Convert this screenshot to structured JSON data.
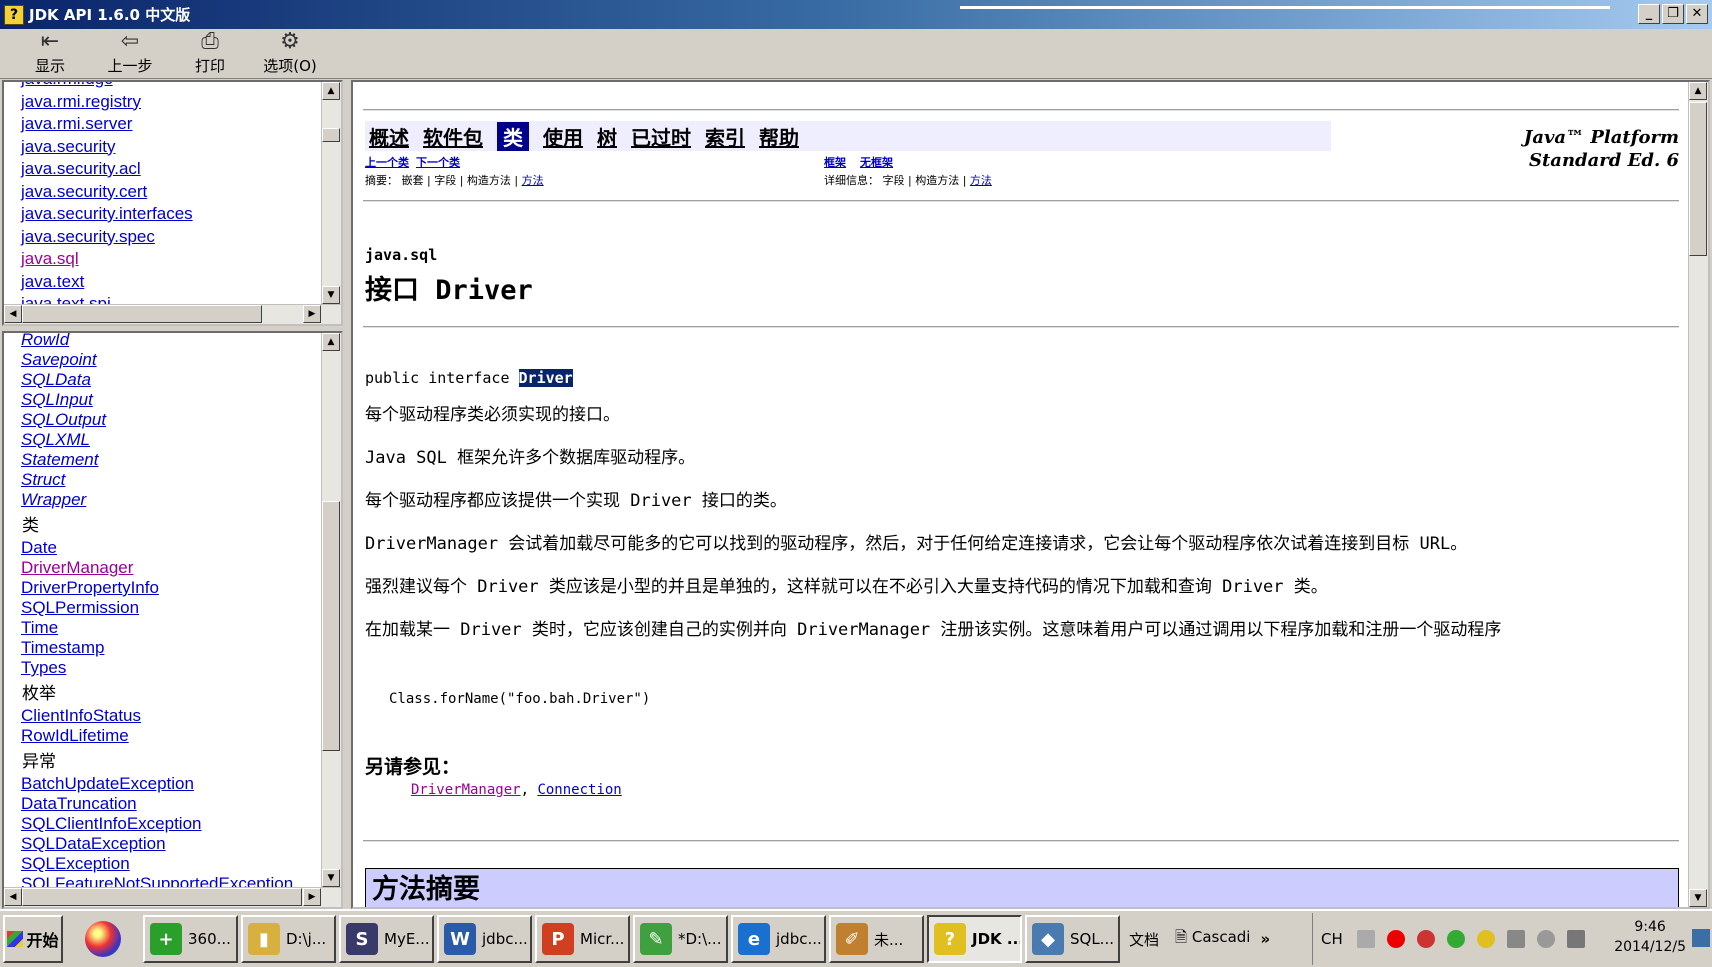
{
  "window": {
    "title": "JDK API 1.6.0 中文版"
  },
  "toolbar": [
    {
      "label": "显示",
      "icon": "show-icon",
      "glyph": "⇤"
    },
    {
      "label": "上一步",
      "icon": "back-icon",
      "glyph": "⇦"
    },
    {
      "label": "打印",
      "icon": "print-icon",
      "glyph": "⎙"
    },
    {
      "label": "选项(O)",
      "icon": "options-icon",
      "glyph": "⚙"
    }
  ],
  "packages": [
    "java.rmi.dgc",
    "java.rmi.registry",
    "java.rmi.server",
    "java.security",
    "java.security.acl",
    "java.security.cert",
    "java.security.interfaces",
    "java.security.spec",
    "java.sql",
    "java.text",
    "java.text.spi"
  ],
  "classlist": {
    "interfaces": [
      "RowId",
      "Savepoint",
      "SQLData",
      "SQLInput",
      "SQLOutput",
      "SQLXML",
      "Statement",
      "Struct",
      "Wrapper"
    ],
    "classes_header": "类",
    "classes": [
      "Date",
      "DriverManager",
      "DriverPropertyInfo",
      "SQLPermission",
      "Time",
      "Timestamp",
      "Types"
    ],
    "enums_header": "枚举",
    "enums": [
      "ClientInfoStatus",
      "RowIdLifetime"
    ],
    "exceptions_header": "异常",
    "exceptions": [
      "BatchUpdateException",
      "DataTruncation",
      "SQLClientInfoException",
      "SQLDataException",
      "SQLException",
      "SQLFeatureNotSupportedException"
    ]
  },
  "doc": {
    "nav": [
      "概述",
      "软件包",
      "类",
      "使用",
      "树",
      "已过时",
      "索引",
      "帮助"
    ],
    "platform_line1": "Java™ Platform",
    "platform_line2": "Standard Ed. 6",
    "prev_class": "上一个类",
    "next_class": "下一个类",
    "frames": "框架",
    "no_frames": "无框架",
    "summary_label": "摘要：",
    "summary_items": "嵌套 | 字段 | 构造方法 | ",
    "summary_method": "方法",
    "detail_label": "详细信息：",
    "detail_items": "字段 | 构造方法 | ",
    "detail_method": "方法",
    "package": "java.sql",
    "title": "接口 Driver",
    "decl_prefix": "public interface ",
    "decl_name": "Driver",
    "p1": "每个驱动程序类必须实现的接口。",
    "p2": "Java SQL 框架允许多个数据库驱动程序。",
    "p3": "每个驱动程序都应该提供一个实现 Driver 接口的类。",
    "p4": "DriverManager 会试着加载尽可能多的它可以找到的驱动程序，然后，对于任何给定连接请求，它会让每个驱动程序依次试着连接到目标 URL。",
    "p5": "强烈建议每个 Driver 类应该是小型的并且是单独的，这样就可以在不必引入大量支持代码的情况下加载和查询 Driver 类。",
    "p6": "在加载某一 Driver 类时，它应该创建自己的实例并向 DriverManager 注册该实例。这意味着用户可以通过调用以下程序加载和注册一个驱动程序",
    "code": "Class.forName(\"foo.bah.Driver\")",
    "see_also": "另请参见：",
    "see_link1": "DriverManager",
    "see_sep": ", ",
    "see_link2": "Connection",
    "method_summary": "方法摘要"
  },
  "taskbar": {
    "start": "开始",
    "tasks": [
      {
        "label": "360...",
        "icon": "360-icon",
        "color": "#2aa02a",
        "glyph": "+"
      },
      {
        "label": "D:\\j...",
        "icon": "folder-icon",
        "color": "#d8b040",
        "glyph": "▮"
      },
      {
        "label": "MyE...",
        "icon": "myeclipse-icon",
        "color": "#3a3a6a",
        "glyph": "S"
      },
      {
        "label": "jdbc...",
        "icon": "word-icon",
        "color": "#2a5aaa",
        "glyph": "W"
      },
      {
        "label": "Micr...",
        "icon": "powerpoint-icon",
        "color": "#d04020",
        "glyph": "P"
      },
      {
        "label": "*D:\\...",
        "icon": "notepad-icon",
        "color": "#40a040",
        "glyph": "✎"
      },
      {
        "label": "jdbc...",
        "icon": "ie-icon",
        "color": "#1a70d0",
        "glyph": "e"
      },
      {
        "label": "未...",
        "icon": "paint-icon",
        "color": "#c08030",
        "glyph": "✐"
      },
      {
        "label": "JDK ...",
        "icon": "help-icon",
        "color": "#e0c020",
        "glyph": "?"
      },
      {
        "label": "SQL...",
        "icon": "mysql-icon",
        "color": "#4a7ab0",
        "glyph": "◆"
      }
    ],
    "docs": "文档",
    "cascadia": "Cascadi",
    "more": "»",
    "lang": "CH",
    "time": "9:46",
    "date": "2014/12/5"
  }
}
